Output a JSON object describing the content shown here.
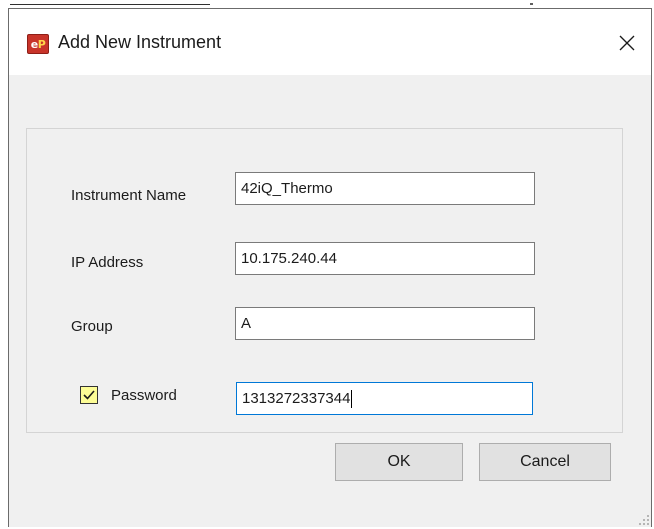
{
  "dialog": {
    "title": "Add New Instrument",
    "icon_text_e": "e",
    "icon_text_p": "P"
  },
  "form": {
    "instrument_name": {
      "label": "Instrument Name",
      "value": "42iQ_Thermo"
    },
    "ip_address": {
      "label": "IP Address",
      "value": "10.175.240.44"
    },
    "group": {
      "label": "Group",
      "value": "A"
    },
    "password": {
      "label": "Password",
      "value": "1313272337344",
      "enabled": true
    }
  },
  "buttons": {
    "ok": "OK",
    "cancel": "Cancel"
  },
  "colors": {
    "focus_border": "#0078d7",
    "checkbox_fill": "#fdfd96",
    "icon_red": "#c8342a"
  }
}
